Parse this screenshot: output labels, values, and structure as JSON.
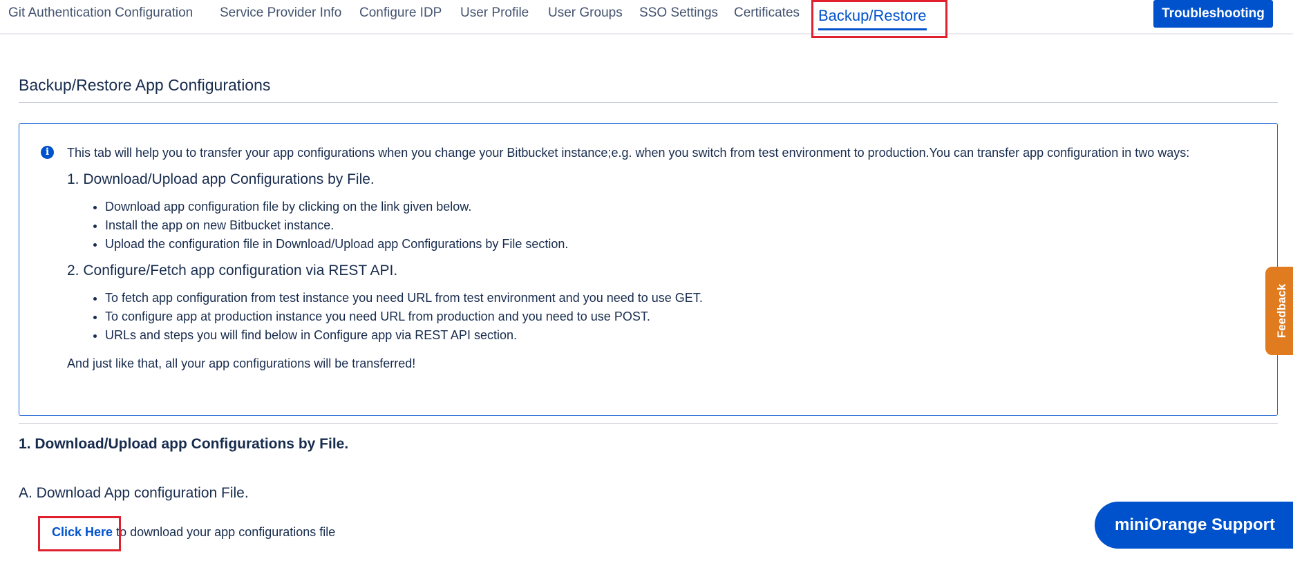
{
  "nav": {
    "tabs": [
      {
        "label": "Git Authentication Configuration"
      },
      {
        "label": "Service Provider Info"
      },
      {
        "label": "Configure IDP"
      },
      {
        "label": "User Profile"
      },
      {
        "label": "User Groups"
      },
      {
        "label": "SSO Settings"
      },
      {
        "label": "Certificates"
      },
      {
        "label": "Backup/Restore",
        "active": true
      }
    ],
    "troubleshooting_label": "Troubleshooting"
  },
  "page": {
    "title": "Backup/Restore App Configurations"
  },
  "info": {
    "icon": "info-icon",
    "intro": "This tab will help you to transfer your app configurations when you change your Bitbucket instance;e.g. when you switch from test environment to production.You can transfer app configuration in two ways:",
    "step1": {
      "heading": "1. Download/Upload app Configurations by File.",
      "items": [
        "Download app configuration file by clicking on the link given below.",
        "Install the app on new Bitbucket instance.",
        "Upload the configuration file in Download/Upload app Configurations by File section."
      ]
    },
    "step2": {
      "heading": "2. Configure/Fetch app configuration via REST API.",
      "items": [
        "To fetch app configuration from test instance you need URL from test environment and you need to use GET.",
        "To configure app at production instance you need URL from production and you need to use POST.",
        "URLs and steps you will find below in Configure app via REST API section."
      ]
    },
    "closing": "And just like that, all your app configurations will be transferred!"
  },
  "section1": {
    "title": "1. Download/Upload app Configurations by File.",
    "subtitle": "A. Download App configuration File.",
    "link_label": "Click Here",
    "link_suffix": " to download your app configurations file"
  },
  "widgets": {
    "feedback_label": "Feedback",
    "support_label": "miniOrange Support"
  },
  "colors": {
    "accent": "#0052cc",
    "highlight": "#e0202e",
    "feedback": "#e07b1f"
  }
}
